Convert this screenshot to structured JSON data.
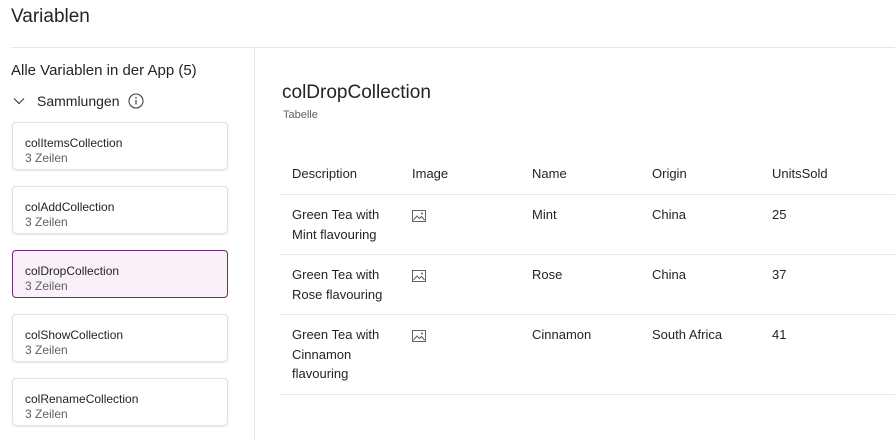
{
  "page": {
    "title": "Variablen"
  },
  "sidebar": {
    "heading": "Alle Variablen in der App (5)",
    "section": {
      "label": "Sammlungen"
    },
    "items": [
      {
        "name": "colItemsCollection",
        "rows": "3 Zeilen"
      },
      {
        "name": "colAddCollection",
        "rows": "3 Zeilen"
      },
      {
        "name": "colDropCollection",
        "rows": "3 Zeilen"
      },
      {
        "name": "colShowCollection",
        "rows": "3 Zeilen"
      },
      {
        "name": "colRenameCollection",
        "rows": "3 Zeilen"
      }
    ],
    "selected_index": 2
  },
  "detail": {
    "title": "colDropCollection",
    "type": "Tabelle",
    "columns": [
      "Description",
      "Image",
      "Name",
      "Origin",
      "UnitsSold"
    ],
    "rows": [
      {
        "description": "Green Tea with Mint flavouring",
        "image_icon": "image-icon",
        "name": "Mint",
        "origin": "China",
        "units_sold": "25"
      },
      {
        "description": "Green Tea with Rose flavouring",
        "image_icon": "image-icon",
        "name": "Rose",
        "origin": "China",
        "units_sold": "37"
      },
      {
        "description": "Green Tea with Cinnamon flavouring",
        "image_icon": "image-icon",
        "name": "Cinnamon",
        "origin": "South Africa",
        "units_sold": "41"
      }
    ]
  },
  "colors": {
    "accent": "#742774",
    "selected_bg": "#f9f0f9",
    "divider": "#e6e6e6"
  }
}
